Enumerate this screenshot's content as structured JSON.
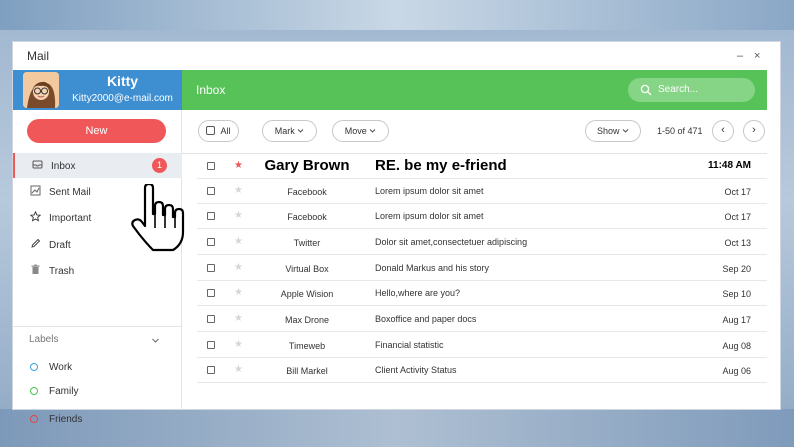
{
  "window": {
    "title": "Mail",
    "minimize": "–",
    "close": "×"
  },
  "profile": {
    "name": "Kitty",
    "email": "Kitty2000@e-mail.com"
  },
  "header": {
    "title": "Inbox",
    "search_placeholder": "Search..."
  },
  "compose": {
    "label": "New"
  },
  "sidebar": {
    "items": [
      {
        "label": "Inbox",
        "icon": "inbox-icon",
        "badge": "1"
      },
      {
        "label": "Sent Mail",
        "icon": "sent-icon"
      },
      {
        "label": "Important",
        "icon": "star-icon"
      },
      {
        "label": "Draft",
        "icon": "draft-icon"
      },
      {
        "label": "Trash",
        "icon": "trash-icon"
      }
    ],
    "labels_title": "Labels",
    "labels": [
      {
        "label": "Work",
        "color": "#3aa3d8"
      },
      {
        "label": "Family",
        "color": "#4cc44c"
      },
      {
        "label": "Friends",
        "color": "#e04545"
      }
    ]
  },
  "toolbar": {
    "all": "All",
    "mark": "Mark",
    "move": "Move",
    "show": "Show",
    "pager": "1-50 of 471",
    "prev": "‹",
    "next": "›"
  },
  "messages": [
    {
      "sender": "Gary Brown",
      "subject": "RE. be my e-friend",
      "date": "11:48 AM",
      "starred": true,
      "unread": true
    },
    {
      "sender": "Facebook",
      "subject": "Lorem ipsum dolor sit amet",
      "date": "Oct 17",
      "starred": false
    },
    {
      "sender": "Facebook",
      "subject": "Lorem ipsum dolor sit amet",
      "date": "Oct 17",
      "starred": false
    },
    {
      "sender": "Twitter",
      "subject": "Dolor sit amet,consectetuer adipiscing",
      "date": "Oct 13",
      "starred": false
    },
    {
      "sender": "Virtual Box",
      "subject": "Donald Markus and his story",
      "date": "Sep 20",
      "starred": false
    },
    {
      "sender": "Apple Wision",
      "subject": "Hello,where are you?",
      "date": "Sep 10",
      "starred": false
    },
    {
      "sender": "Max Drone",
      "subject": "Boxoffice and paper docs",
      "date": "Aug 17",
      "starred": false
    },
    {
      "sender": "Timeweb",
      "subject": "Financial statistic",
      "date": "Aug 08",
      "starred": false
    },
    {
      "sender": "Bill Markel",
      "subject": "Client Activity Status",
      "date": "Aug 06",
      "starred": false
    }
  ],
  "colors": {
    "accent_green": "#57c257",
    "accent_red": "#ef5758",
    "profile_blue": "#3e8fd2"
  }
}
